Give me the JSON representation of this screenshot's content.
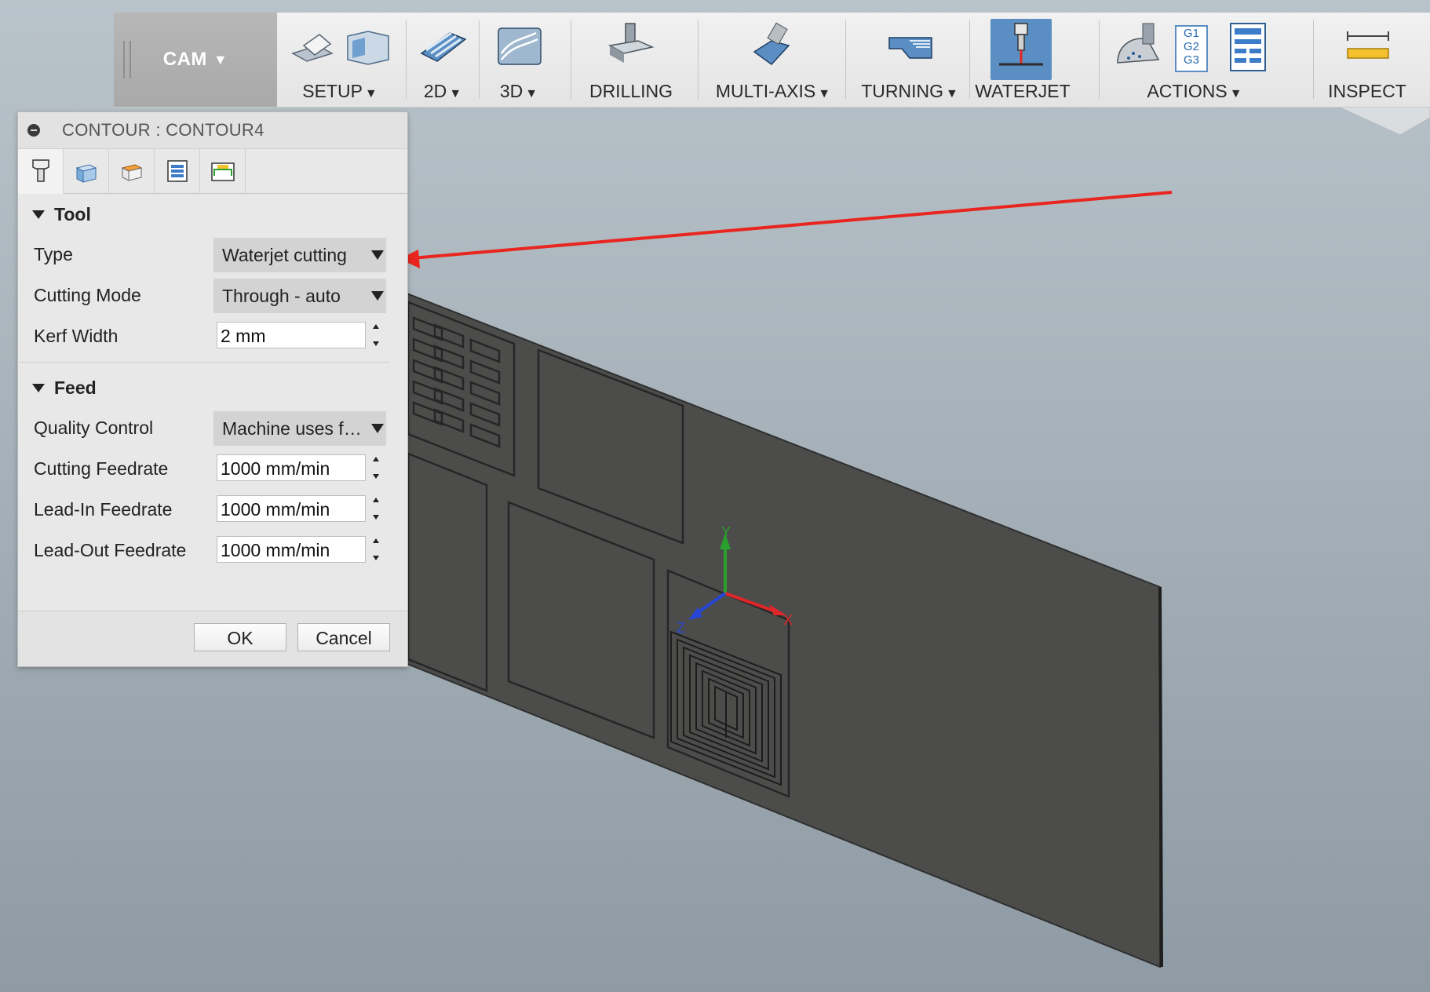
{
  "toolbar": {
    "workspace": "CAM",
    "groups": [
      {
        "label": "SETUP",
        "has_menu": true
      },
      {
        "label": "2D",
        "has_menu": true
      },
      {
        "label": "3D",
        "has_menu": true
      },
      {
        "label": "DRILLING",
        "has_menu": false
      },
      {
        "label": "MULTI-AXIS",
        "has_menu": true
      },
      {
        "label": "TURNING",
        "has_menu": true
      },
      {
        "label": "WATERJET",
        "has_menu": false,
        "active": true
      },
      {
        "label": "ACTIONS",
        "has_menu": true
      },
      {
        "label": "INSPECT",
        "has_menu": false
      }
    ],
    "actions_icon_text": [
      "G1",
      "G2",
      "G3"
    ]
  },
  "dialog": {
    "title": "CONTOUR : CONTOUR4",
    "tabs": [
      "tool-tab",
      "geometry-tab",
      "heights-tab",
      "passes-tab",
      "linking-tab"
    ],
    "tool_section": {
      "heading": "Tool",
      "type_label": "Type",
      "type_value": "Waterjet cutting",
      "cutting_mode_label": "Cutting Mode",
      "cutting_mode_value": "Through - auto",
      "kerf_width_label": "Kerf Width",
      "kerf_width_value": "2 mm"
    },
    "feed_section": {
      "heading": "Feed",
      "quality_control_label": "Quality Control",
      "quality_control_value": "Machine uses feed",
      "cutting_feedrate_label": "Cutting Feedrate",
      "cutting_feedrate_value": "1000 mm/min",
      "lead_in_feedrate_label": "Lead-In Feedrate",
      "lead_in_feedrate_value": "1000 mm/min",
      "lead_out_feedrate_label": "Lead-Out Feedrate",
      "lead_out_feedrate_value": "1000 mm/min"
    },
    "ok_label": "OK",
    "cancel_label": "Cancel"
  },
  "viewport": {
    "axis_labels": {
      "y": "Y",
      "x": "X",
      "z": "Z"
    },
    "colors": {
      "x_axis": "#e0262a",
      "y_axis": "#2aa12c",
      "z_axis": "#2746d6",
      "annotation_arrow": "#e8261f",
      "accent": "#5b8fc4"
    }
  }
}
